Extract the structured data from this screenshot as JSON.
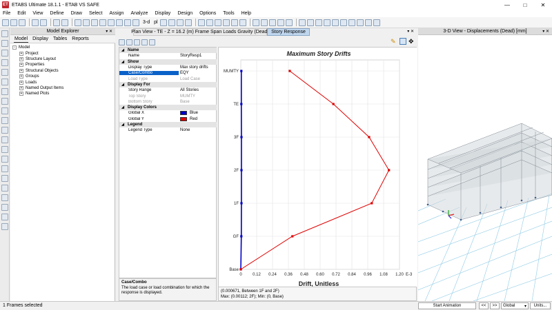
{
  "window": {
    "logo": "ET",
    "title": "ETABS Ultimate 18.1.1 - ETAB VS SAFE",
    "controls": [
      "minimize-icon",
      "maximize-icon",
      "close-icon"
    ]
  },
  "menu": [
    "File",
    "Edit",
    "View",
    "Define",
    "Draw",
    "Select",
    "Assign",
    "Analyze",
    "Display",
    "Design",
    "Options",
    "Tools",
    "Help"
  ],
  "toolbar": {
    "zoom_label": "3-d",
    "plan_label": "pl"
  },
  "model_explorer": {
    "title": "Model Explorer",
    "tabs": [
      "Model",
      "Display",
      "Tables",
      "Reports"
    ],
    "tree": [
      {
        "label": "Model",
        "level": 0,
        "exp": "-"
      },
      {
        "label": "Project",
        "level": 1,
        "exp": "+"
      },
      {
        "label": "Structure Layout",
        "level": 1,
        "exp": "+"
      },
      {
        "label": "Properties",
        "level": 1,
        "exp": "+"
      },
      {
        "label": "Structural Objects",
        "level": 1,
        "exp": "+"
      },
      {
        "label": "Groups",
        "level": 1,
        "exp": "+"
      },
      {
        "label": "Loads",
        "level": 1,
        "exp": "+"
      },
      {
        "label": "Named Output Items",
        "level": 1,
        "exp": "+"
      },
      {
        "label": "Named Plots",
        "level": 1,
        "exp": "+"
      }
    ]
  },
  "tabs": {
    "plan": "Plan View - TE - Z = 16.2 (m)  Frame Span Loads Gravity (Dead)",
    "story": "Story Response"
  },
  "properties": {
    "rows": [
      {
        "type": "cat",
        "label": "Name"
      },
      {
        "type": "row",
        "key": "Name",
        "value": "StoryResp1"
      },
      {
        "type": "cat",
        "label": "Show"
      },
      {
        "type": "row",
        "key": "Display Type",
        "value": "Max story drifts"
      },
      {
        "type": "row",
        "key": "Case/Combo",
        "value": "EQY",
        "selected": true
      },
      {
        "type": "row",
        "key": "Load Type",
        "value": "Load Case",
        "dim": true
      },
      {
        "type": "cat",
        "label": "Display For"
      },
      {
        "type": "row",
        "key": "Story Range",
        "value": "All Stories"
      },
      {
        "type": "row",
        "key": "Top Story",
        "value": "MUMTY",
        "dim": true
      },
      {
        "type": "row",
        "key": "Bottom Story",
        "value": "Base",
        "dim": true
      },
      {
        "type": "cat",
        "label": "Display Colors"
      },
      {
        "type": "row",
        "key": "Global X",
        "value": "Blue",
        "swatch": "#0000cc"
      },
      {
        "type": "row",
        "key": "Global Y",
        "value": "Red",
        "swatch": "#e00000"
      },
      {
        "type": "cat",
        "label": "Legend"
      },
      {
        "type": "row",
        "key": "Legend Type",
        "value": "None"
      }
    ],
    "description": {
      "title": "Case/Combo",
      "text": "The load case or load combination for which the response is displayed."
    }
  },
  "chart_status": {
    "line1": "(0.000671, Between 1F and 2F)",
    "line2": "Max: (0.00112; 2F);  Min: (0, Base)"
  },
  "chart_data": {
    "type": "line",
    "title": "Maximum Story Drifts",
    "xlabel": "Drift, Unitless",
    "x_unit_label": "E-3",
    "x_ticks": [
      "0",
      "0.12",
      "0.24",
      "0.36",
      "0.48",
      "0.60",
      "0.72",
      "0.84",
      "0.96",
      "1.08",
      "1.20"
    ],
    "x_tick_values": [
      0,
      0.12,
      0.24,
      0.36,
      0.48,
      0.6,
      0.72,
      0.84,
      0.96,
      1.08,
      1.2
    ],
    "xlim": [
      0,
      1.2
    ],
    "stories": [
      "Base",
      "GF",
      "1F",
      "2F",
      "3F",
      "TE",
      "MUMTY"
    ],
    "series": [
      {
        "name": "Global X",
        "color": "#0000cc",
        "values": [
          0,
          0.004,
          0.005,
          0.005,
          0.005,
          0.004,
          0.004
        ]
      },
      {
        "name": "Global Y",
        "color": "#e00000",
        "values": [
          0,
          0.39,
          0.99,
          1.12,
          0.97,
          0.7,
          0.37
        ]
      }
    ],
    "grid": true,
    "legend": "none"
  },
  "view3d": {
    "title": "3-D View  - Displacements (Dead)  [mm]"
  },
  "statusbar": {
    "left": "1 Frames selected",
    "start_animation": "Start Animation",
    "prev": "<<",
    "next": ">>",
    "coord_system": "Global",
    "units": "Units..."
  }
}
